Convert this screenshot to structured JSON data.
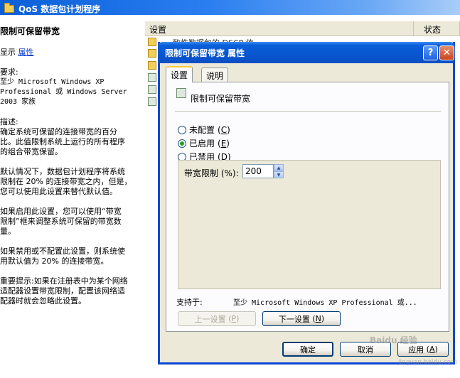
{
  "background_window": {
    "title": "QoS 数据包计划程序",
    "left_pane": {
      "heading": "限制可保留带宽",
      "show_prefix": "显示 ",
      "properties_link": "属性",
      "requirements_label": "要求:",
      "requirements_lines": [
        "至少 Microsoft Windows XP",
        "Professional 或 Windows Server",
        "2003 家族"
      ],
      "description_label": "描述:",
      "description_lines": [
        "确定系统可保留的连接带宽的百分",
        "比。此值限制系统上运行的所有程序",
        "的组合带宽保留。",
        "",
        "默认情况下，数据包计划程序将系统",
        "限制在 20% 的连接带宽之内，但是，",
        "您可以使用此设置来替代默认值。",
        "",
        "如果启用此设置，您可以使用“带宽",
        "限制”框来调整系统可保留的带宽数",
        "量。",
        "",
        "如果禁用或不配置此设置，则系统使",
        "用默认值为 20% 的连接带宽。",
        "",
        "重要提示:如果在注册表中为某个网络",
        "适配器设置带宽限制，配置该网络适",
        "配器时就会忽略此设置。"
      ]
    },
    "list": {
      "col_setting": "设置",
      "col_status": "状态",
      "partial_row": "一致性数据包的 DSCP 值"
    }
  },
  "dialog": {
    "title": "限制可保留带宽 属性",
    "help_label": "?",
    "close_label": "✕",
    "tabs": [
      {
        "label": "设置"
      },
      {
        "label": "说明"
      }
    ],
    "setting_name": "限制可保留带宽",
    "radio": [
      {
        "label": "未配置",
        "key": "C",
        "checked": false
      },
      {
        "label": "已启用",
        "key": "E",
        "checked": true
      },
      {
        "label": "已禁用",
        "key": "D",
        "checked": false
      }
    ],
    "bandwidth_label": "带宽限制 (%):",
    "bandwidth_value": "200",
    "supported_label": "支持于:",
    "supported_value": "至少 Microsoft Windows XP Professional 或...",
    "prev_button": {
      "label": "上一设置",
      "key": "P"
    },
    "next_button": {
      "label": "下一设置",
      "key": "N"
    },
    "ok_label": "确定",
    "cancel_label": "取消",
    "apply_label": "应用",
    "apply_key": "A"
  },
  "watermark": {
    "text": "Baidu 经验",
    "sub": "jingyan.baidu.com"
  }
}
